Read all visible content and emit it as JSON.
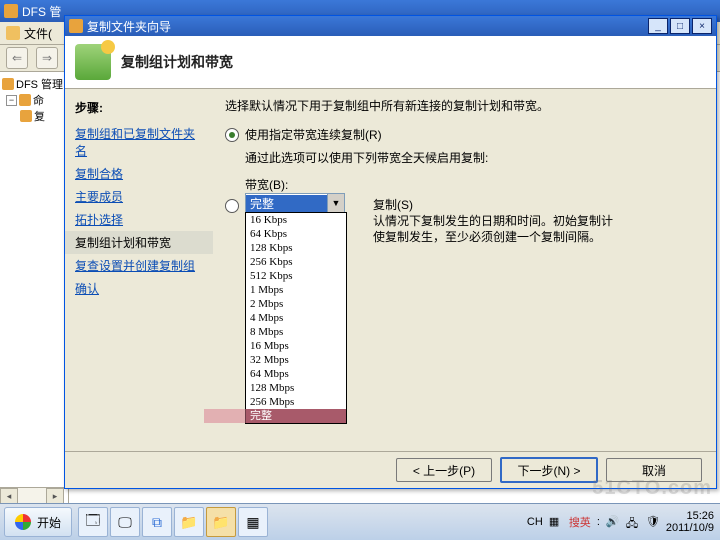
{
  "bgWindow": {
    "title": "DFS 管",
    "menu": "文件(",
    "toolbarLabel": "DFS 管理",
    "tree": {
      "root": "命",
      "child": "复"
    }
  },
  "wizard": {
    "title": "复制文件夹向导",
    "header": "复制组计划和带宽",
    "navHeader": "步骤:",
    "steps": [
      "复制组和已复制文件夹名",
      "复制合格",
      "主要成员",
      "拓扑选择",
      "复制组计划和带宽",
      "复查设置并创建复制组",
      "确认"
    ],
    "currentStep": 4,
    "content": {
      "desc": "选择默认情况下用于复制组中所有新连接的复制计划和带宽。",
      "radio1": "使用指定带宽连续复制(R)",
      "radio1sub": "通过此选项可以使用下列带宽全天候启用复制:",
      "bandwidthLabel": "带宽(B):",
      "selected": "完整",
      "options": [
        "16 Kbps",
        "64 Kbps",
        "128 Kbps",
        "256 Kbps",
        "512 Kbps",
        "1 Mbps",
        "2 Mbps",
        "4 Mbps",
        "8 Mbps",
        "16 Mbps",
        "32 Mbps",
        "64 Mbps",
        "128 Mbps",
        "256 Mbps",
        "完整"
      ],
      "radio2tail": "复制(S)",
      "radio2sub": "认情况下复制发生的日期和时间。初始复制计\n使复制发生，至少必须创建一个复制间隔。"
    },
    "buttons": {
      "prev": "< 上一步(P)",
      "next": "下一步(N) >",
      "cancel": "取消"
    }
  },
  "taskbar": {
    "start": "开始",
    "ime": {
      "ch": "CH",
      "txt": "搜英"
    },
    "clock": {
      "time": "15:26",
      "date": "2011/10/9"
    }
  },
  "watermark": "51CTO.com"
}
